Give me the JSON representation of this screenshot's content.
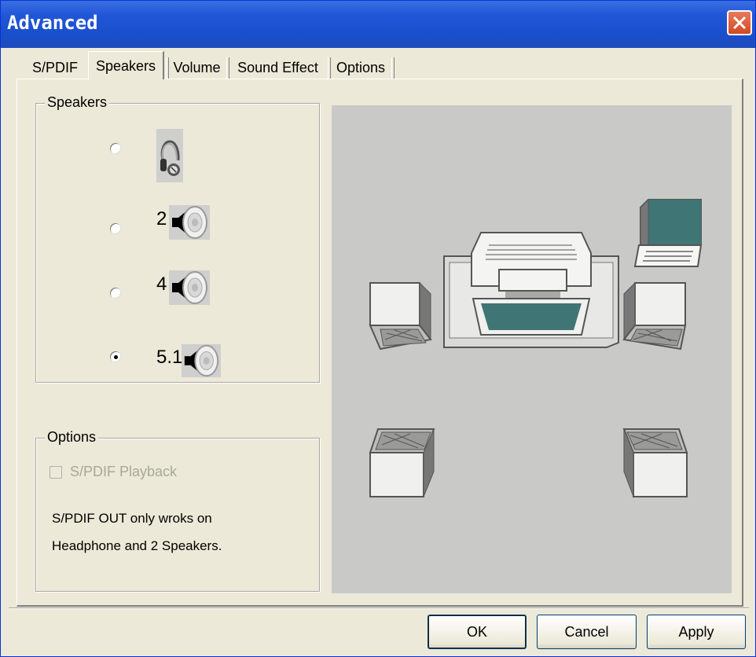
{
  "window": {
    "title": "Advanced",
    "close_icon": "close-icon"
  },
  "tabs": [
    {
      "label": "S/PDIF",
      "selected": false
    },
    {
      "label": "Speakers",
      "selected": true
    },
    {
      "label": "Volume",
      "selected": false
    },
    {
      "label": "Sound Effect",
      "selected": false
    },
    {
      "label": "Options",
      "selected": false
    }
  ],
  "speakers_group": {
    "legend": "Speakers",
    "options": [
      {
        "label": "",
        "icon": "headphone-icon",
        "selected": false
      },
      {
        "label": "2",
        "icon": "speaker-icon",
        "selected": false
      },
      {
        "label": "4",
        "icon": "speaker-icon",
        "selected": false
      },
      {
        "label": "5.1",
        "icon": "speaker-icon",
        "selected": true
      }
    ]
  },
  "options_group": {
    "legend": "Options",
    "checkbox_label": "S/PDIF Playback",
    "checkbox_checked": false,
    "checkbox_enabled": false,
    "note_line1": "S/PDIF OUT only wroks on",
    "note_line2": "Headphone and 2 Speakers."
  },
  "preview": {
    "layout": "5.1 speaker configuration illustration"
  },
  "buttons": {
    "ok": "OK",
    "cancel": "Cancel",
    "apply": "Apply"
  },
  "colors": {
    "titlebar": "#2156d8",
    "dialog_bg": "#ece9d8",
    "preview_bg": "#c9cac8",
    "screen": "#3f7575"
  }
}
